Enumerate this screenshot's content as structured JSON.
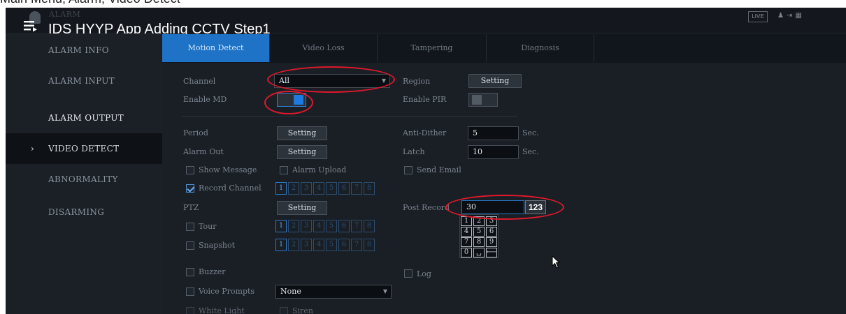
{
  "breadcrumb": "Main Menu, Alarm, Video Detect",
  "header": {
    "small_title": "ALARM",
    "video_title": "IDS HYYP App Adding CCTV Step1",
    "live_label": "LIVE",
    "top_right_icons": [
      "user-icon",
      "logout-icon",
      "grid-icon"
    ]
  },
  "sidebar": {
    "items": [
      {
        "label": "ALARM INFO"
      },
      {
        "label": "ALARM INPUT"
      },
      {
        "label": "ALARM OUTPUT"
      },
      {
        "label": "VIDEO DETECT",
        "active": true,
        "chevron": "›"
      },
      {
        "label": "ABNORMALITY"
      },
      {
        "label": "DISARMING"
      }
    ]
  },
  "tabs": [
    {
      "label": "Motion Detect",
      "active": true
    },
    {
      "label": "Video Loss"
    },
    {
      "label": "Tampering"
    },
    {
      "label": "Diagnosis"
    }
  ],
  "form": {
    "channel": {
      "label": "Channel",
      "value": "All"
    },
    "region": {
      "label": "Region",
      "button": "Setting"
    },
    "enable_md": {
      "label": "Enable MD",
      "on": true
    },
    "enable_pir": {
      "label": "Enable PIR",
      "on": false
    },
    "period": {
      "label": "Period",
      "button": "Setting"
    },
    "anti_dither": {
      "label": "Anti-Dither",
      "value": "5",
      "unit": "Sec."
    },
    "alarm_out": {
      "label": "Alarm Out",
      "button": "Setting"
    },
    "latch": {
      "label": "Latch",
      "value": "10",
      "unit": "Sec."
    },
    "show_message": {
      "label": "Show Message",
      "checked": false
    },
    "alarm_upload": {
      "label": "Alarm Upload",
      "checked": false
    },
    "send_email": {
      "label": "Send Email",
      "checked": false
    },
    "record_channel": {
      "label": "Record Channel",
      "checked": true,
      "channels": [
        "1",
        "2",
        "3",
        "4",
        "5",
        "6",
        "7",
        "8"
      ]
    },
    "ptz": {
      "label": "PTZ",
      "button": "Setting"
    },
    "post_record": {
      "label": "Post Record",
      "value": "30",
      "ime_tag": "123"
    },
    "tour": {
      "label": "Tour",
      "checked": false,
      "channels": [
        "1",
        "2",
        "3",
        "4",
        "5",
        "6",
        "7",
        "8"
      ]
    },
    "snapshot": {
      "label": "Snapshot",
      "checked": false,
      "channels": [
        "1",
        "2",
        "3",
        "4",
        "5",
        "6",
        "7",
        "8"
      ]
    },
    "buzzer": {
      "label": "Buzzer",
      "checked": false
    },
    "log": {
      "label": "Log",
      "checked": false
    },
    "voice_prompts": {
      "label": "Voice Prompts",
      "value": "None"
    },
    "white_light": {
      "label": "White Light"
    },
    "siren": {
      "label": "Siren"
    }
  },
  "numpad": {
    "keys": [
      "1",
      "2",
      "3",
      "4",
      "5",
      "6",
      "7",
      "8",
      "9",
      "0",
      "␣",
      "⟵"
    ]
  },
  "colors": {
    "accent": "#1e73c6",
    "annotation": "#e0192a",
    "background": "#1a1f26",
    "sidebar": "#1b2027"
  }
}
